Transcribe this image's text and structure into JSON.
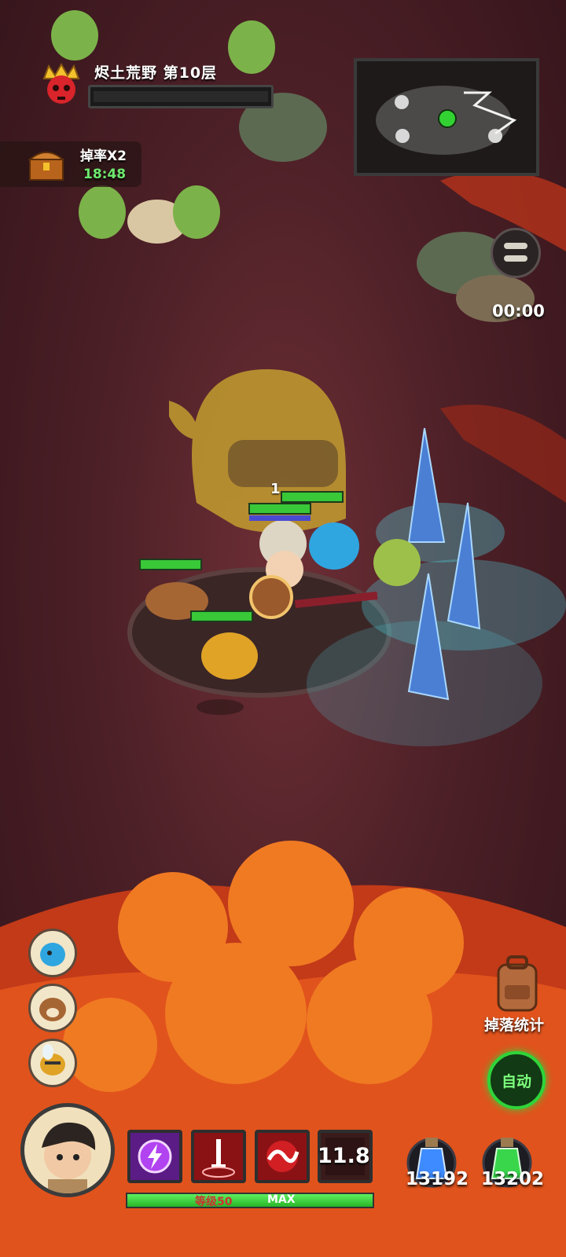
{
  "stage": {
    "title": "烬土荒野 第10层",
    "boss_hp_fraction": 0.0
  },
  "buff": {
    "label": "掉率X2",
    "timer": "18:48"
  },
  "battle": {
    "timer": "00:00",
    "damage_popup": "1"
  },
  "side_buttons": {
    "drop_stats": "掉落统计",
    "auto": "自动"
  },
  "pets": [
    {
      "name_icon": "blue-dragon-pet-icon"
    },
    {
      "name_icon": "dog-pet-icon"
    },
    {
      "name_icon": "bee-pet-icon"
    }
  ],
  "skills": [
    {
      "icon": "lightning-skill-icon",
      "color": "#8d2bd6"
    },
    {
      "icon": "sword-slash-skill-icon",
      "color": "#c4181c"
    },
    {
      "icon": "swirl-skill-icon",
      "color": "#c4181c"
    },
    {
      "icon": "cooldown-skill-icon",
      "color": "#3a1b1b",
      "cooldown": "11.8"
    }
  ],
  "player": {
    "level_label": "等级50",
    "max_label": "MAX",
    "exp_fraction": 1.0
  },
  "potions": [
    {
      "icon": "blue-potion-icon",
      "count": "13192",
      "color": "#3d8bff"
    },
    {
      "icon": "green-potion-icon",
      "count": "13202",
      "color": "#39d64b"
    }
  ],
  "colors": {
    "hp_green": "#38c838",
    "lava": "#e8431a",
    "accent_green": "#2fd43a"
  }
}
